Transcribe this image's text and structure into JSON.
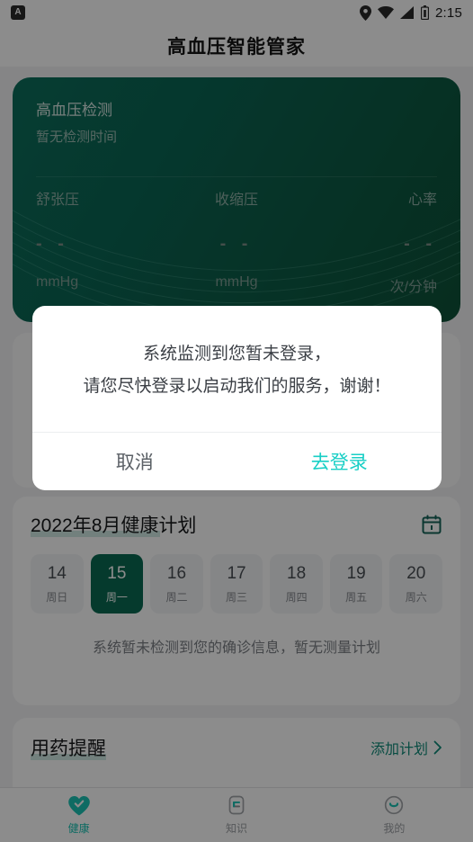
{
  "status_bar": {
    "app_badge": "A",
    "time": "2:15",
    "icons": [
      "location-pin-icon",
      "wifi-icon",
      "signal-icon",
      "battery-icon"
    ]
  },
  "header": {
    "title": "高血压智能管家"
  },
  "measure_card": {
    "title": "高血压检测",
    "subtitle": "暂无检测时间",
    "metrics": [
      {
        "label": "舒张压",
        "value": "- -",
        "unit": "mmHg"
      },
      {
        "label": "收缩压",
        "value": "- -",
        "unit": "mmHg"
      },
      {
        "label": "心率",
        "value": "- -",
        "unit": "次/分钟"
      }
    ]
  },
  "plan_card": {
    "title": "2022年8月健康计划",
    "calendar_icon": "calendar-icon",
    "days": [
      {
        "num": "14",
        "name": "周日",
        "selected": false
      },
      {
        "num": "15",
        "name": "周一",
        "selected": true
      },
      {
        "num": "16",
        "name": "周二",
        "selected": false
      },
      {
        "num": "17",
        "name": "周三",
        "selected": false
      },
      {
        "num": "18",
        "name": "周四",
        "selected": false
      },
      {
        "num": "19",
        "name": "周五",
        "selected": false
      },
      {
        "num": "20",
        "name": "周六",
        "selected": false
      }
    ],
    "empty_text": "系统暂未检测到您的确诊信息，暂无测量计划"
  },
  "med_card": {
    "title": "用药提醒",
    "add_label": "添加计划",
    "chevron": "chevron-right-icon"
  },
  "bottom_nav": {
    "items": [
      {
        "label": "健康",
        "icon": "heart-check-icon",
        "active": true
      },
      {
        "label": "知识",
        "icon": "document-icon",
        "active": false
      },
      {
        "label": "我的",
        "icon": "smiley-face-icon",
        "active": false
      }
    ]
  },
  "dialog": {
    "line1": "系统监测到您暂未登录，",
    "line2": "请您尽快登录以启动我们的服务，谢谢！",
    "cancel_label": "取消",
    "confirm_label": "去登录"
  },
  "colors": {
    "accent_teal": "#19cfc6",
    "brand_green": "#0a6b52",
    "link_green": "#0e8a78",
    "card_gradient_from": "#0b6f5c",
    "card_gradient_to": "#0d5238"
  }
}
